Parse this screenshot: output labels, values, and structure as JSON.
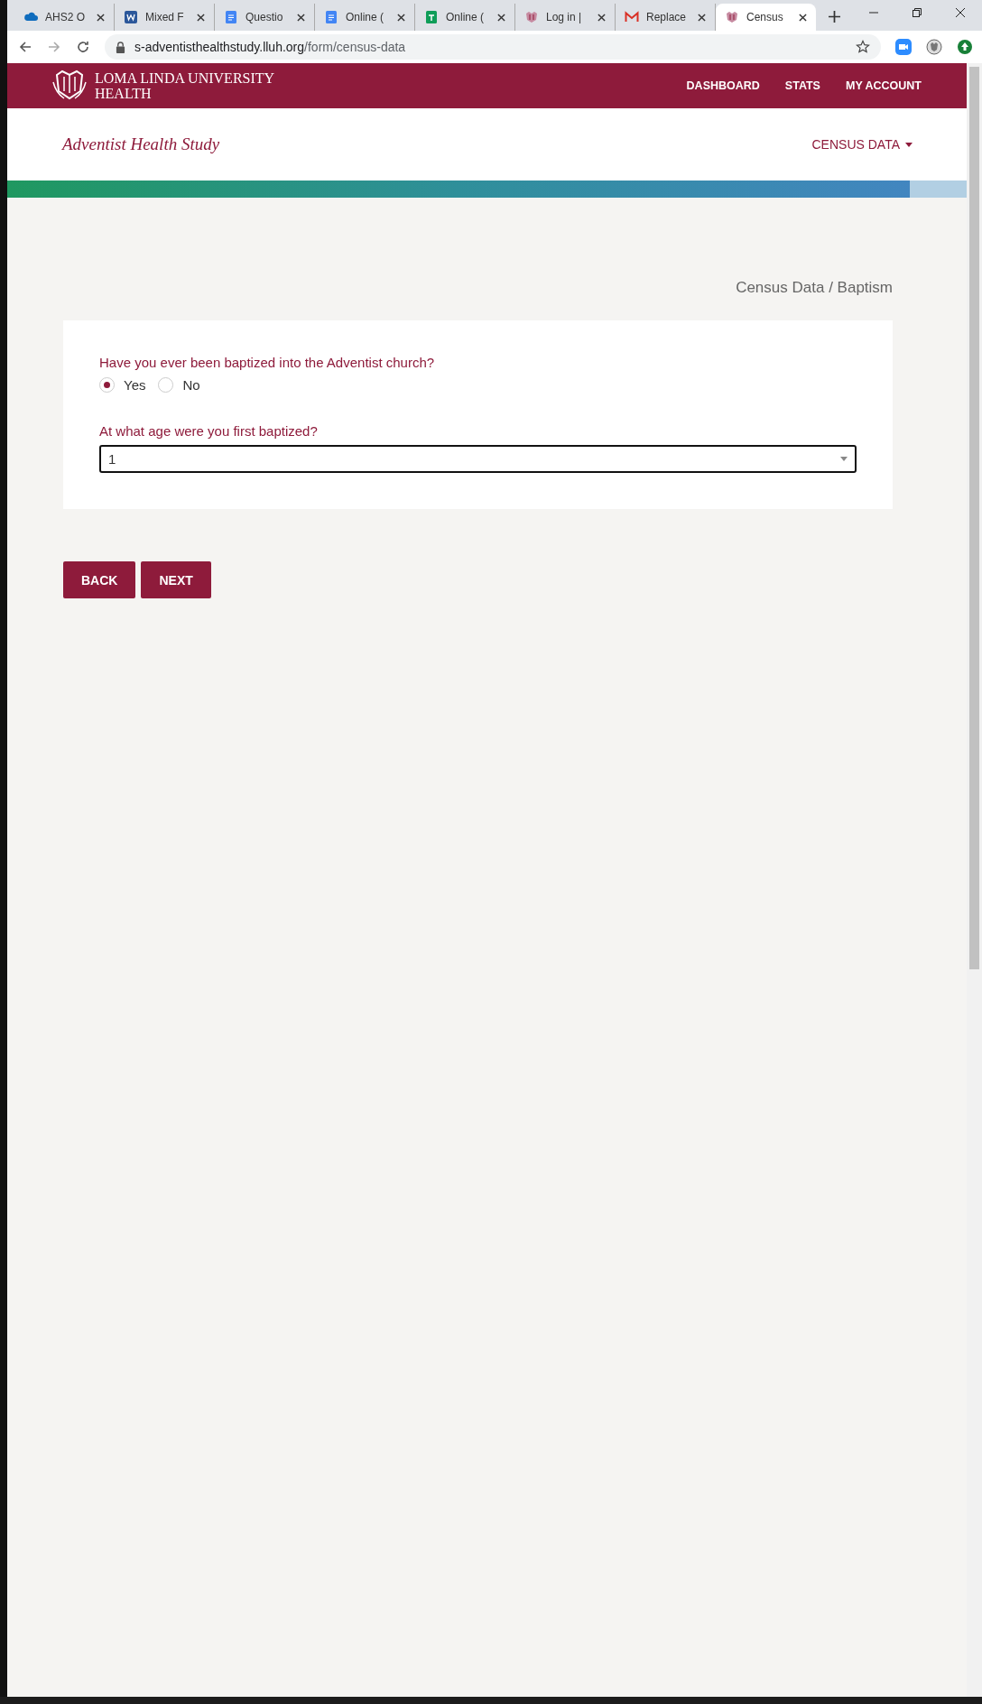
{
  "browser": {
    "tabs": [
      {
        "title": "AHS2 O",
        "selected": false
      },
      {
        "title": "Mixed F",
        "selected": false
      },
      {
        "title": "Questio",
        "selected": false
      },
      {
        "title": "Online (",
        "selected": false
      },
      {
        "title": "Online (",
        "selected": false
      },
      {
        "title": "Log in |",
        "selected": false
      },
      {
        "title": "Replace",
        "selected": false
      },
      {
        "title": "Census",
        "selected": true
      }
    ],
    "url_host": "s-adventisthealthstudy.lluh.org",
    "url_path": "/form/census-data"
  },
  "header": {
    "logo_text": "LOMA LINDA UNIVERSITY HEALTH",
    "nav": [
      "DASHBOARD",
      "STATS",
      "MY ACCOUNT"
    ]
  },
  "subheader": {
    "title": "Adventist Health Study",
    "menu": "CENSUS DATA"
  },
  "breadcrumb": "Census Data / Baptism",
  "form": {
    "question_1": "Have you ever been baptized into the Adventist church?",
    "options": [
      {
        "label": "Yes",
        "selected": true
      },
      {
        "label": "No",
        "selected": false
      }
    ],
    "question_2": "At what age were you first baptized?",
    "age_value": "1"
  },
  "buttons": [
    "BACK",
    "NEXT"
  ]
}
